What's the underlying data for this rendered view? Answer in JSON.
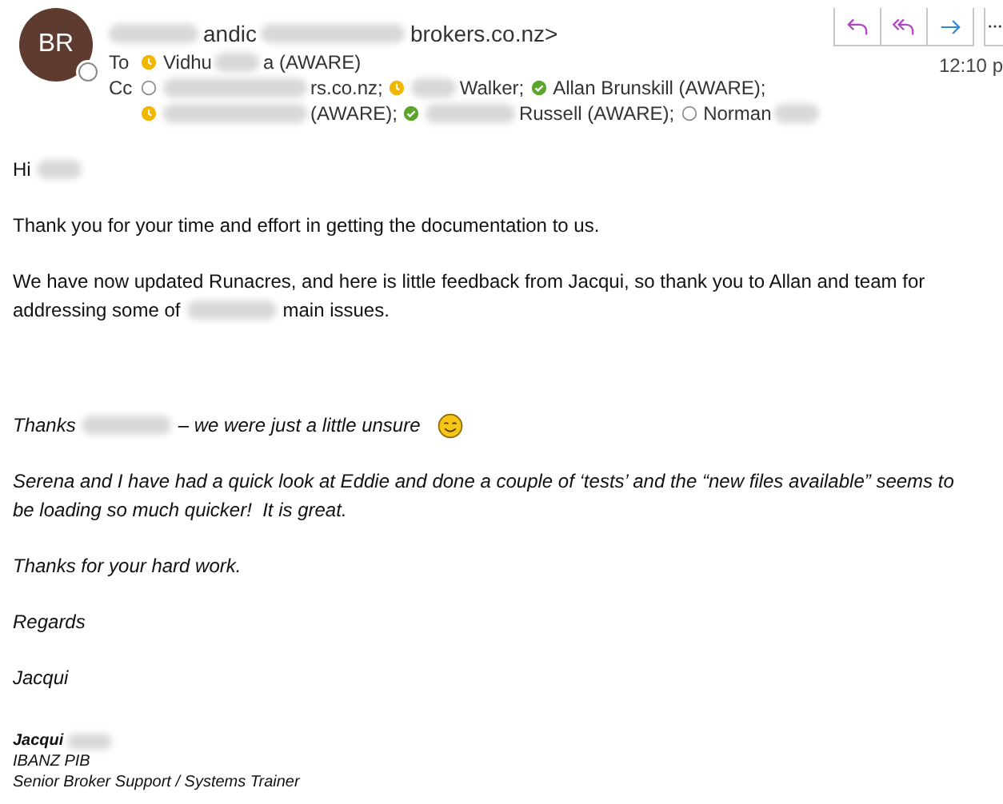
{
  "sender": {
    "initials": "BR",
    "kind": "offline",
    "segments": [
      {
        "kind": "blur-m"
      },
      {
        "kind": "text",
        "text": "andic"
      },
      {
        "kind": "blur-l"
      },
      {
        "kind": "text",
        "text": "brokers.co.nz>"
      }
    ]
  },
  "actions": [
    {
      "kind": "reply"
    },
    {
      "kind": "reply-all"
    },
    {
      "kind": "forward"
    },
    {
      "kind": "more"
    }
  ],
  "time": "12:10 p",
  "to": {
    "label": "To",
    "recipients": [
      {
        "kind": "away",
        "segments": [
          {
            "kind": "text",
            "text": "Vidhu"
          },
          {
            "kind": "blur-s"
          },
          {
            "kind": "text",
            "text": "a (AWARE)"
          }
        ]
      }
    ]
  },
  "cc": {
    "label": "Cc",
    "recipients": [
      {
        "kind": "offline",
        "segments": [
          {
            "kind": "blur-l"
          },
          {
            "kind": "text",
            "text": "rs.co.nz;"
          }
        ]
      },
      {
        "kind": "away",
        "segments": [
          {
            "kind": "blur-s"
          },
          {
            "kind": "text",
            "text": "Walker;"
          }
        ]
      },
      {
        "kind": "available",
        "segments": [
          {
            "kind": "text",
            "text": "Allan Brunskill (AWARE);"
          }
        ]
      },
      {
        "kind": "away",
        "segments": [
          {
            "kind": "blur-l"
          },
          {
            "kind": "text",
            "text": "(AWARE);"
          }
        ]
      },
      {
        "kind": "available",
        "segments": [
          {
            "kind": "blur-m"
          },
          {
            "kind": "text",
            "text": "Russell (AWARE);"
          }
        ]
      },
      {
        "kind": "offline",
        "segments": [
          {
            "kind": "text",
            "text": "Norman"
          },
          {
            "kind": "blur-s"
          }
        ]
      }
    ]
  },
  "body": {
    "intro": [
      [
        [
          {
            "kind": "text",
            "text": "Hi"
          },
          {
            "kind": "blur-s"
          }
        ]
      ],
      [
        [
          {
            "kind": "text",
            "text": "Thank you for your time and effort in getting the documentation to us."
          }
        ]
      ],
      [
        [
          {
            "kind": "text",
            "text": "We have now updated Runacres, and here is little feedback from Jacqui, so thank you to Allan and team for"
          }
        ],
        [
          {
            "kind": "text",
            "text": "addressing some of"
          },
          {
            "kind": "blur-m"
          },
          {
            "kind": "text",
            "text": "main issues."
          }
        ]
      ]
    ],
    "quoted": [
      [
        [
          {
            "kind": "text",
            "text": "Thanks"
          },
          {
            "kind": "blur-m"
          },
          {
            "kind": "text",
            "text": "– we were just a little unsure"
          },
          {
            "kind": "smiley"
          }
        ]
      ],
      [
        [
          {
            "kind": "text",
            "text": "Serena and I have had a quick look at Eddie and done a couple of ‘tests’ and the “new files available” seems to"
          }
        ],
        [
          {
            "kind": "text",
            "text": "be loading so much quicker!  It is great."
          }
        ]
      ],
      [
        [
          {
            "kind": "text",
            "text": "Thanks for your hard work."
          }
        ]
      ],
      [
        [
          {
            "kind": "text",
            "text": "Regards"
          }
        ]
      ],
      [
        [
          {
            "kind": "text",
            "text": "Jacqui"
          }
        ]
      ]
    ]
  },
  "signature": {
    "name": [
      {
        "kind": "text",
        "text": "Jacqui"
      },
      {
        "kind": "blur-s"
      }
    ],
    "lines": [
      "IBANZ PIB",
      "Senior Broker Support / Systems Trainer"
    ]
  }
}
